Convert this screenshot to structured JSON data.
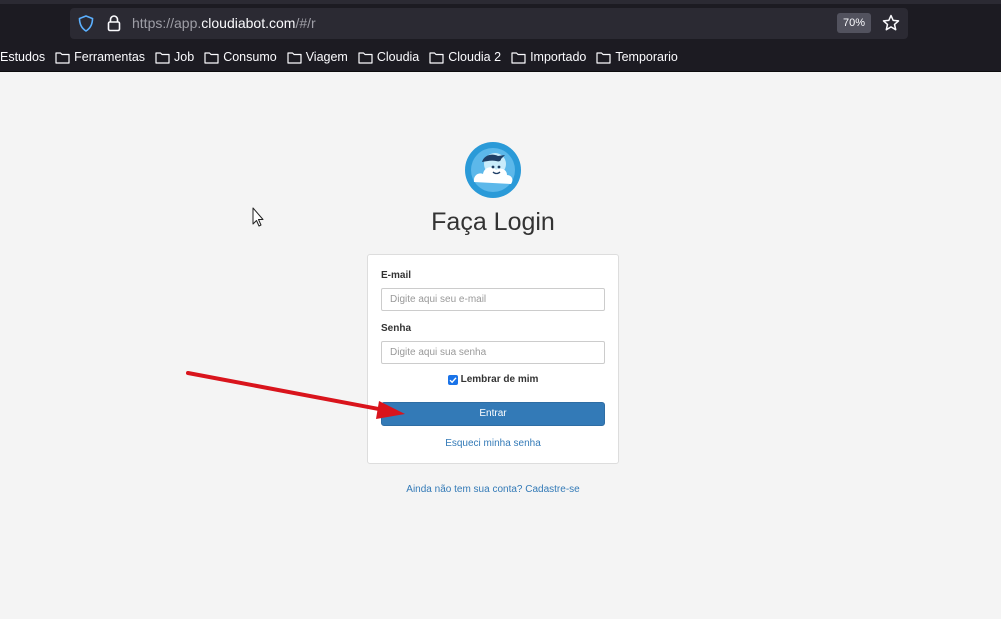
{
  "browser": {
    "url_prefix": "https://app.",
    "url_domain": "cloudiabot.com",
    "url_suffix": "/#/r",
    "zoom": "70%",
    "bookmarks": [
      "Estudos",
      "Ferramentas",
      "Job",
      "Consumo",
      "Viagem",
      "Cloudia",
      "Cloudia 2",
      "Importado",
      "Temporario"
    ]
  },
  "login": {
    "title": "Faça Login",
    "email_label": "E-mail",
    "email_placeholder": "Digite aqui seu e-mail",
    "password_label": "Senha",
    "password_placeholder": "Digite aqui sua senha",
    "remember_label": "Lembrar de mim",
    "remember_checked": true,
    "submit_label": "Entrar",
    "forgot_label": "Esqueci minha senha",
    "signup_label": "Ainda não tem sua conta? Cadastre-se"
  },
  "colors": {
    "primary": "#337ab7",
    "annotation_arrow": "#d9141c",
    "chrome_bg": "#1c1b22"
  }
}
